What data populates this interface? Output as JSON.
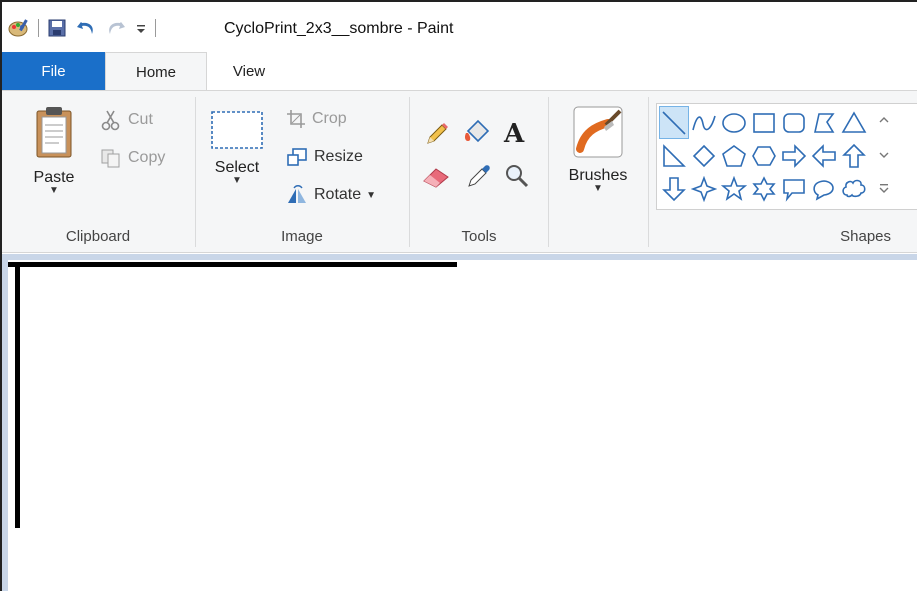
{
  "app": {
    "title": "CycloPrint_2x3__sombre - Paint"
  },
  "quick_access": [
    {
      "name": "paint-icon"
    },
    {
      "name": "save-icon"
    },
    {
      "name": "undo-icon"
    },
    {
      "name": "redo-icon"
    },
    {
      "name": "customize-dropdown-icon"
    }
  ],
  "tabs": {
    "file": "File",
    "home": "Home",
    "view": "View"
  },
  "ribbon": {
    "clipboard": {
      "paste": "Paste",
      "cut": "Cut",
      "copy": "Copy",
      "group_label": "Clipboard"
    },
    "image": {
      "select": "Select",
      "crop": "Crop",
      "resize": "Resize",
      "rotate": "Rotate",
      "group_label": "Image"
    },
    "tools": {
      "group_label": "Tools"
    },
    "brushes": {
      "label": "Brushes"
    },
    "shapes": {
      "group_label": "Shapes"
    }
  },
  "colors": {
    "file_tab": "#1a6fc9",
    "ribbon_bg": "#f5f6f7",
    "workspace": "#c9d6e8",
    "shape_stroke": "#2f6db5"
  }
}
